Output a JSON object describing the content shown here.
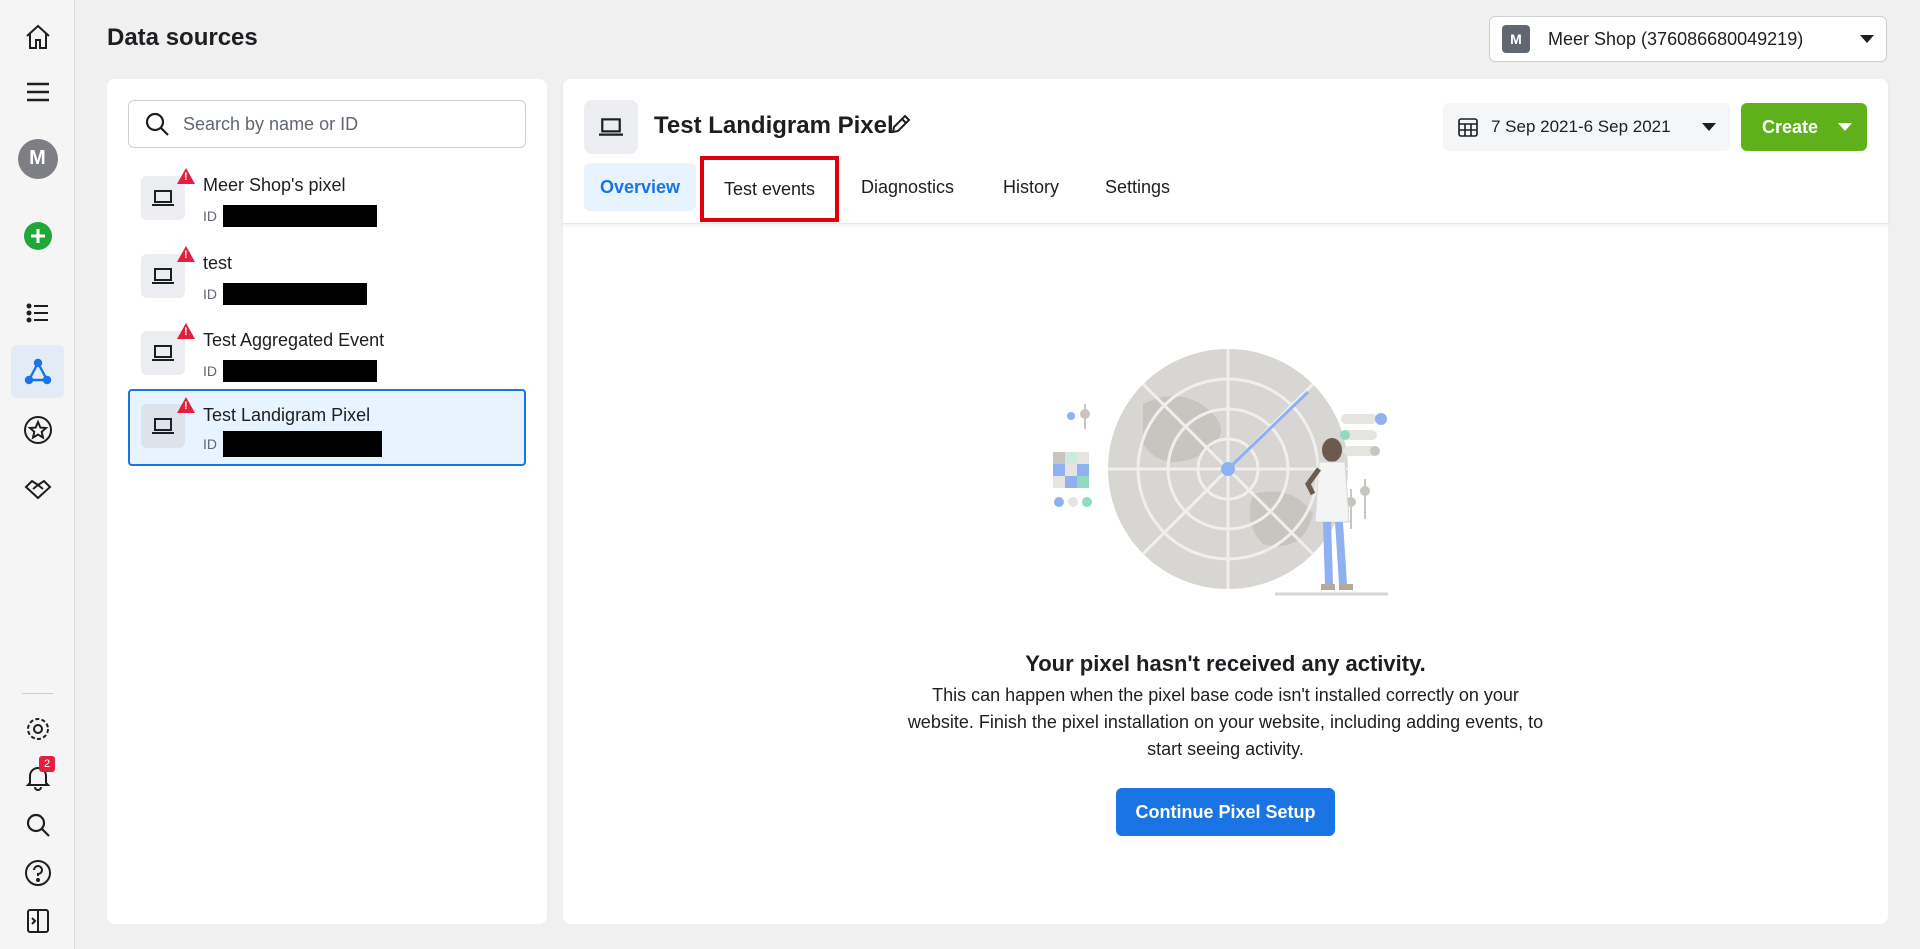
{
  "page": {
    "title": "Data sources"
  },
  "account": {
    "badge": "M",
    "name": "Meer Shop (376086680049219)"
  },
  "rail": {
    "avatar": "M",
    "notification_count": "2",
    "icons": [
      "home-icon",
      "menu-icon",
      "avatar",
      "add-icon",
      "list-icon",
      "data-sources-icon",
      "star-icon",
      "handshake-icon",
      "settings-icon",
      "notifications-icon",
      "search-icon",
      "help-icon",
      "sidebar-toggle-icon"
    ]
  },
  "search": {
    "placeholder": "Search by name or ID"
  },
  "pixels": [
    {
      "name": "Meer Shop's pixel",
      "id_label": "ID"
    },
    {
      "name": "test",
      "id_label": "ID"
    },
    {
      "name": "Test Aggregated Event",
      "id_label": "ID"
    },
    {
      "name": "Test Landigram Pixel",
      "id_label": "ID"
    }
  ],
  "main": {
    "title": "Test Landigram Pixel",
    "date_range": "7 Sep 2021-6 Sep 2021",
    "create_label": "Create",
    "tabs": [
      "Overview",
      "Test events",
      "Diagnostics",
      "History",
      "Settings"
    ],
    "active_tab": "Overview",
    "empty_title": "Your pixel hasn't received any activity.",
    "empty_text": "This can happen when the pixel base code isn't installed correctly on your website. Finish the pixel installation on your website, including adding events, to start seeing activity.",
    "continue_label": "Continue Pixel Setup"
  },
  "colors": {
    "accent": "#1b74e4",
    "create": "#5fb11c",
    "warning": "#e41e3f",
    "highlight": "#e0000b"
  }
}
